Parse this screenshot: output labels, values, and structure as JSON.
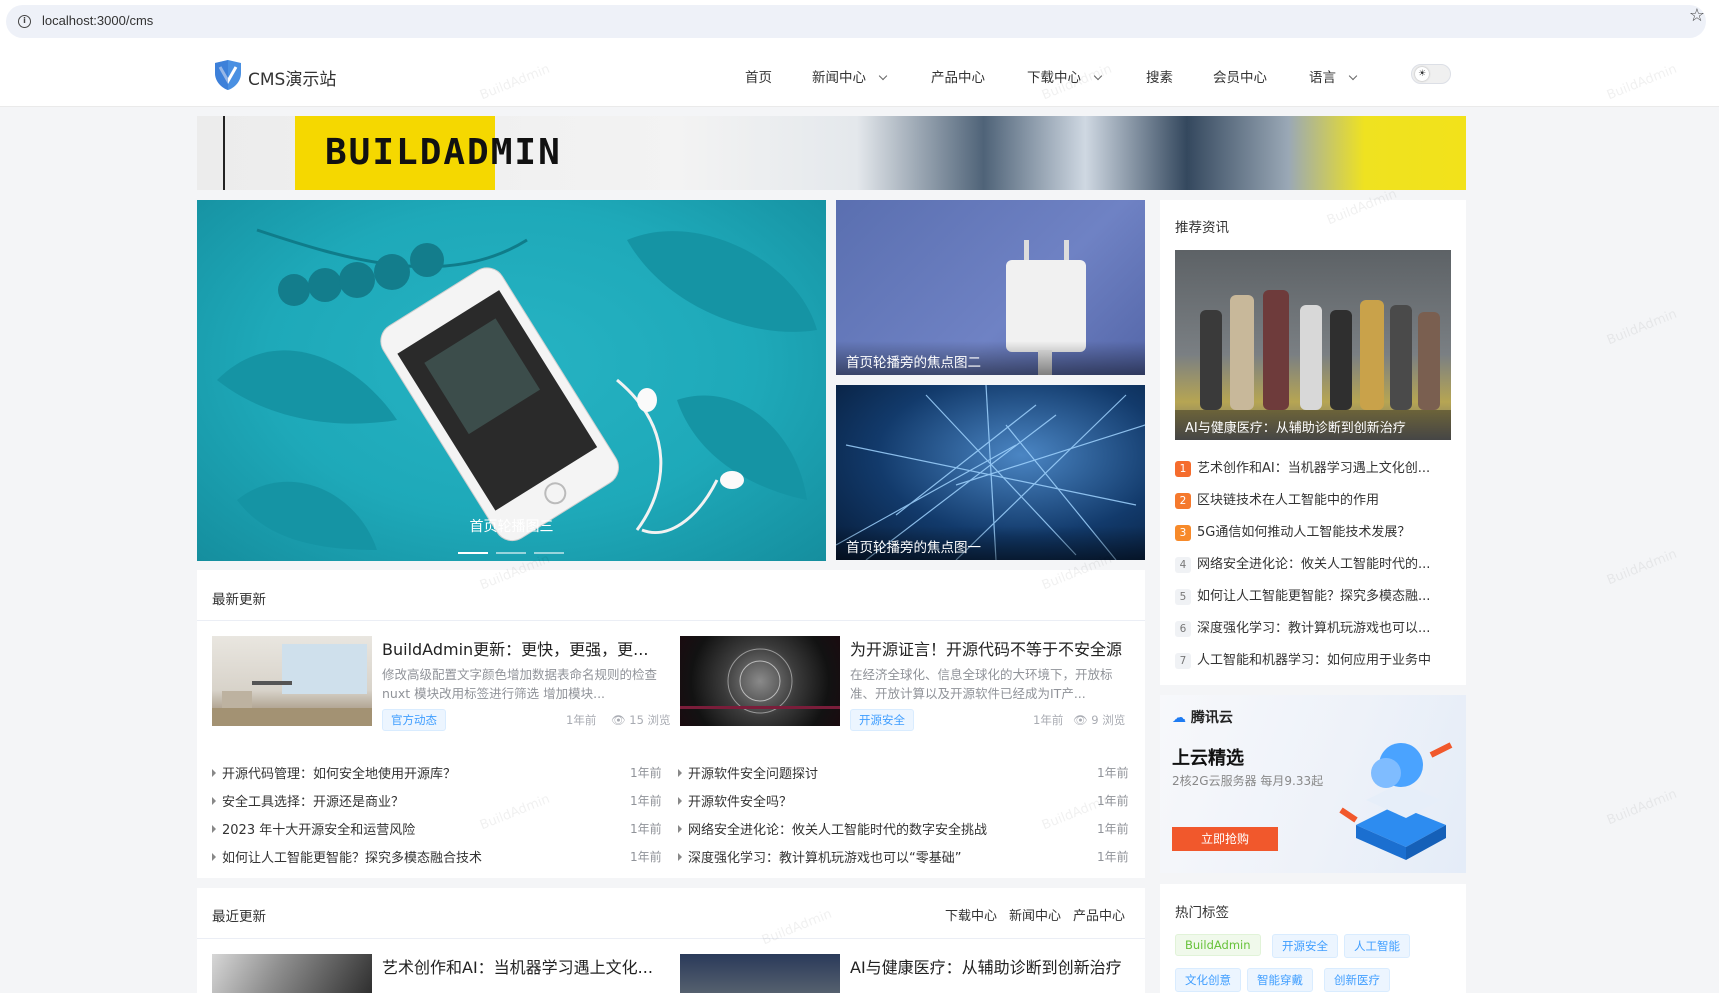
{
  "browser": {
    "url": "localhost:3000/cms"
  },
  "header": {
    "site_title": "CMS演示站",
    "nav": [
      {
        "label": "首页",
        "has_dropdown": false
      },
      {
        "label": "新闻中心",
        "has_dropdown": true
      },
      {
        "label": "产品中心",
        "has_dropdown": false
      },
      {
        "label": "下载中心",
        "has_dropdown": true
      },
      {
        "label": "搜素",
        "has_dropdown": false
      },
      {
        "label": "会员中心",
        "has_dropdown": false
      },
      {
        "label": "语言",
        "has_dropdown": true
      }
    ]
  },
  "banner": {
    "text": "BUILDADMIN"
  },
  "carousel": {
    "main_caption": "首页轮播图三",
    "side_top_caption": "首页轮播旁的焦点图二",
    "side_bottom_caption": "首页轮播旁的焦点图一"
  },
  "latest": {
    "title": "最新更新",
    "featured": [
      {
        "title": "BuildAdmin更新：更快，更强，更...",
        "desc": "修改高级配置文字颜色增加数据表命名规则的检查 nuxt 模块改用标签进行筛选 增加模块...",
        "tag": "官方动态",
        "time": "1年前",
        "views": "15 浏览"
      },
      {
        "title": "为开源证言！开源代码不等于不安全源",
        "desc": "在经济全球化、信息全球化的大环境下，开放标准、开放计算以及开源软件已经成为IT产...",
        "tag": "开源安全",
        "time": "1年前",
        "views": "9 浏览"
      }
    ],
    "list_left": [
      {
        "title": "开源代码管理：如何安全地使用开源库？",
        "time": "1年前"
      },
      {
        "title": "安全工具选择：开源还是商业？",
        "time": "1年前"
      },
      {
        "title": "2023 年十大开源安全和运营风险",
        "time": "1年前"
      },
      {
        "title": "如何让人工智能更智能？探究多模态融合技术",
        "time": "1年前"
      }
    ],
    "list_right": [
      {
        "title": "开源软件安全问题探讨",
        "time": "1年前"
      },
      {
        "title": "开源软件安全吗？",
        "time": "1年前"
      },
      {
        "title": "网络安全进化论：攸关人工智能时代的数字安全挑战",
        "time": "1年前"
      },
      {
        "title": "深度强化学习：教计算机玩游戏也可以“零基础”",
        "time": "1年前"
      }
    ]
  },
  "recent": {
    "title": "最近更新",
    "tabs": [
      "下载中心",
      "新闻中心",
      "产品中心"
    ],
    "featured": [
      {
        "title": "艺术创作和AI：当机器学习遇上文化..."
      },
      {
        "title": "AI与健康医疗：从辅助诊断到创新治疗"
      }
    ]
  },
  "recommend": {
    "title": "推荐资讯",
    "featured_caption": "AI与健康医疗：从辅助诊断到创新治疗",
    "items": [
      {
        "rank": "1",
        "title": "艺术创作和AI：当机器学习遇上文化创..."
      },
      {
        "rank": "2",
        "title": "区块链技术在人工智能中的作用"
      },
      {
        "rank": "3",
        "title": "5G通信如何推动人工智能技术发展？"
      },
      {
        "rank": "4",
        "title": "网络安全进化论：攸关人工智能时代的..."
      },
      {
        "rank": "5",
        "title": "如何让人工智能更智能？探究多模态融..."
      },
      {
        "rank": "6",
        "title": "深度强化学习：教计算机玩游戏也可以..."
      },
      {
        "rank": "7",
        "title": "人工智能和机器学习：如何应用于业务中"
      }
    ]
  },
  "ad": {
    "brand": "腾讯云",
    "headline": "上云精选",
    "sub": "2核2G云服务器 每月9.33起",
    "button": "立即抢购"
  },
  "hot_tags": {
    "title": "热门标签",
    "tags": [
      {
        "label": "BuildAdmin",
        "color": "#67c23a"
      },
      {
        "label": "开源安全",
        "color": "#409eff"
      },
      {
        "label": "人工智能",
        "color": "#409eff"
      },
      {
        "label": "文化创意",
        "color": "#409eff"
      },
      {
        "label": "智能穿戴",
        "color": "#409eff"
      },
      {
        "label": "创新医疗",
        "color": "#409eff"
      }
    ]
  },
  "watermark": "BuildAdmin"
}
